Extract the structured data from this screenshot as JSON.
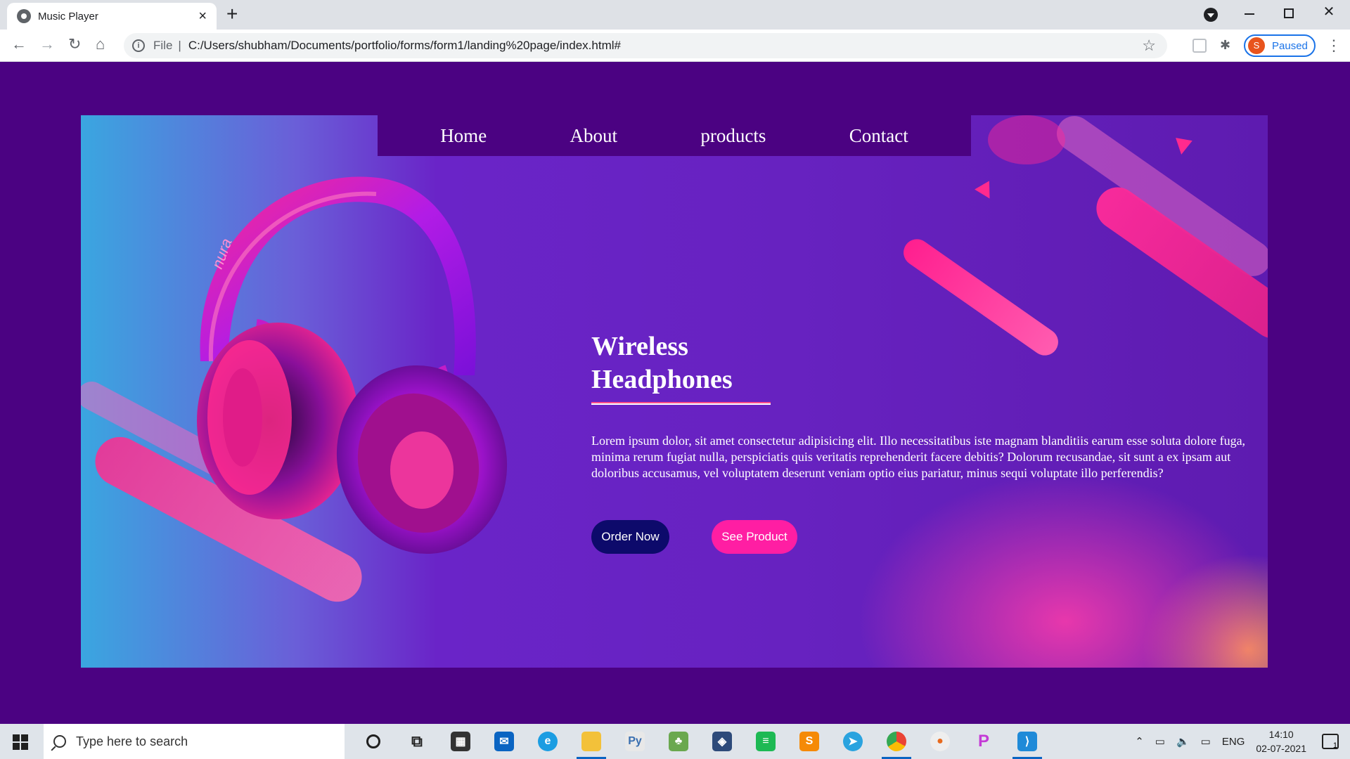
{
  "browser": {
    "tab_title": "Music Player",
    "tab_close": "×",
    "new_tab": "+",
    "scheme_label": "File",
    "separator": "|",
    "url": "C:/Users/shubham/Documents/portfolio/forms/form1/landing%20page/index.html#",
    "profile_initial": "S",
    "profile_status": "Paused"
  },
  "page": {
    "nav": {
      "items": [
        "Home",
        "About",
        "products",
        "Contact"
      ]
    },
    "hero": {
      "title_line1": "Wireless",
      "title_line2": "Headphones",
      "body": "Lorem ipsum dolor, sit amet consectetur adipisicing elit. Illo necessitatibus iste magnam blanditiis earum esse soluta dolore fuga, minima rerum fugiat nulla, perspiciatis quis veritatis reprehenderit facere debitis? Dolorum recusandae, sit sunt a ex ipsam aut doloribus accusamus, vel voluptatem deserunt veniam optio eius pariatur, minus sequi voluptate illo perferendis?",
      "order_button": "Order Now",
      "see_button": "See Product",
      "headphone_brand": "nura"
    },
    "colors": {
      "page_bg": "#4b0282",
      "order_button": "#0d0a6b",
      "see_button": "#ff1ea3",
      "accent_pink": "#ff2a8e"
    }
  },
  "taskbar": {
    "search_placeholder": "Type here to search",
    "apps": [
      "cortana-icon",
      "task-view-icon",
      "store-icon",
      "mail-icon",
      "edge-icon",
      "file-explorer-icon",
      "python-icon",
      "app-icon",
      "vmware-icon",
      "spotify-icon",
      "sublime-icon",
      "telegram-icon",
      "chrome-icon",
      "app-icon",
      "picsart-icon",
      "vscode-icon"
    ],
    "language": "ENG",
    "time": "14:10",
    "date": "02-07-2021",
    "notification_count": "1"
  }
}
